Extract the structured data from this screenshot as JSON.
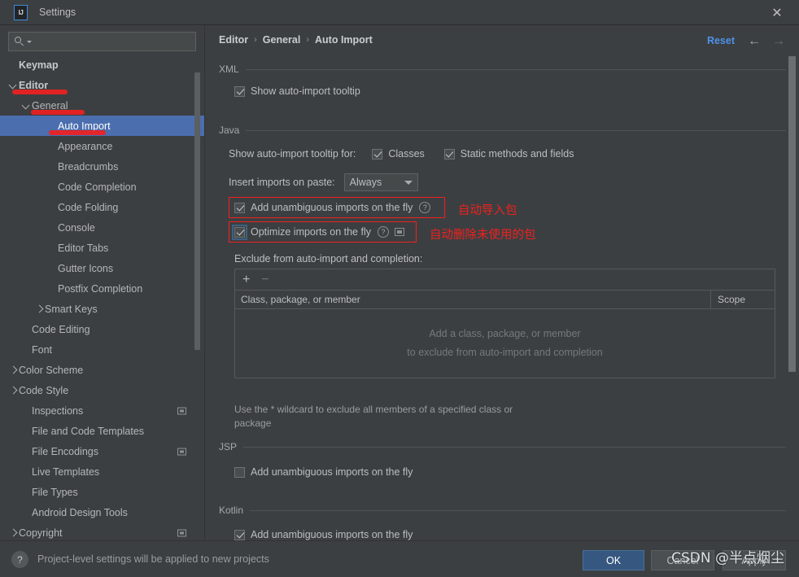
{
  "window": {
    "title": "Settings",
    "logo_text": "IJ",
    "close_label": "✕"
  },
  "sidebar": {
    "search": {
      "value": "",
      "placeholder": ""
    },
    "items": [
      {
        "label": "Keymap",
        "indent": 0,
        "arrow": "none",
        "bold": true,
        "selected": false,
        "badge": false
      },
      {
        "label": "Editor",
        "indent": 0,
        "arrow": "expanded",
        "bold": true,
        "selected": false,
        "badge": false
      },
      {
        "label": "General",
        "indent": 1,
        "arrow": "expanded",
        "bold": false,
        "selected": false,
        "badge": false
      },
      {
        "label": "Auto Import",
        "indent": 3,
        "arrow": "none",
        "bold": false,
        "selected": true,
        "badge": false
      },
      {
        "label": "Appearance",
        "indent": 3,
        "arrow": "none",
        "bold": false,
        "selected": false,
        "badge": false
      },
      {
        "label": "Breadcrumbs",
        "indent": 3,
        "arrow": "none",
        "bold": false,
        "selected": false,
        "badge": false
      },
      {
        "label": "Code Completion",
        "indent": 3,
        "arrow": "none",
        "bold": false,
        "selected": false,
        "badge": false
      },
      {
        "label": "Code Folding",
        "indent": 3,
        "arrow": "none",
        "bold": false,
        "selected": false,
        "badge": false
      },
      {
        "label": "Console",
        "indent": 3,
        "arrow": "none",
        "bold": false,
        "selected": false,
        "badge": false
      },
      {
        "label": "Editor Tabs",
        "indent": 3,
        "arrow": "none",
        "bold": false,
        "selected": false,
        "badge": false
      },
      {
        "label": "Gutter Icons",
        "indent": 3,
        "arrow": "none",
        "bold": false,
        "selected": false,
        "badge": false
      },
      {
        "label": "Postfix Completion",
        "indent": 3,
        "arrow": "none",
        "bold": false,
        "selected": false,
        "badge": false
      },
      {
        "label": "Smart Keys",
        "indent": 2,
        "arrow": "collapsed",
        "bold": false,
        "selected": false,
        "badge": false
      },
      {
        "label": "Code Editing",
        "indent": 1,
        "arrow": "none",
        "bold": false,
        "selected": false,
        "badge": false
      },
      {
        "label": "Font",
        "indent": 1,
        "arrow": "none",
        "bold": false,
        "selected": false,
        "badge": false
      },
      {
        "label": "Color Scheme",
        "indent": 0,
        "arrow": "collapsed",
        "bold": false,
        "selected": false,
        "badge": false
      },
      {
        "label": "Code Style",
        "indent": 0,
        "arrow": "collapsed",
        "bold": false,
        "selected": false,
        "badge": false
      },
      {
        "label": "Inspections",
        "indent": 1,
        "arrow": "none",
        "bold": false,
        "selected": false,
        "badge": true
      },
      {
        "label": "File and Code Templates",
        "indent": 1,
        "arrow": "none",
        "bold": false,
        "selected": false,
        "badge": false
      },
      {
        "label": "File Encodings",
        "indent": 1,
        "arrow": "none",
        "bold": false,
        "selected": false,
        "badge": true
      },
      {
        "label": "Live Templates",
        "indent": 1,
        "arrow": "none",
        "bold": false,
        "selected": false,
        "badge": false
      },
      {
        "label": "File Types",
        "indent": 1,
        "arrow": "none",
        "bold": false,
        "selected": false,
        "badge": false
      },
      {
        "label": "Android Design Tools",
        "indent": 1,
        "arrow": "none",
        "bold": false,
        "selected": false,
        "badge": false
      },
      {
        "label": "Copyright",
        "indent": 0,
        "arrow": "collapsed",
        "bold": false,
        "selected": false,
        "badge": true
      }
    ]
  },
  "breadcrumb": {
    "items": [
      "Editor",
      "General",
      "Auto Import"
    ],
    "separator": "›"
  },
  "header": {
    "reset_label": "Reset",
    "back_arrow": "←",
    "forward_arrow": "→"
  },
  "sections": {
    "xml": {
      "title": "XML",
      "show_tooltip": {
        "label": "Show auto-import tooltip",
        "checked": true
      }
    },
    "java": {
      "title": "Java",
      "tooltip_for_label": "Show auto-import tooltip for:",
      "classes": {
        "label": "Classes",
        "checked": true
      },
      "static_methods": {
        "label": "Static methods and fields",
        "checked": true
      },
      "insert_imports_label": "Insert imports on paste:",
      "insert_imports_value": "Always",
      "add_unambiguous": {
        "label": "Add unambiguous imports on the fly",
        "checked": true,
        "help": "?"
      },
      "optimize_imports": {
        "label": "Optimize imports on the fly",
        "checked": true,
        "help": "?"
      },
      "exclude_label": "Exclude from auto-import and completion:",
      "toolbar": {
        "add": "+",
        "remove": "−"
      },
      "table_headers": [
        "Class, package, or member",
        "Scope"
      ],
      "empty_line1": "Add a class, package, or member",
      "empty_line2": "to exclude from auto-import and completion",
      "hint_line1": "Use the * wildcard to exclude all members of a specified class or",
      "hint_line2": "package"
    },
    "jsp": {
      "title": "JSP",
      "add_unambiguous": {
        "label": "Add unambiguous imports on the fly",
        "checked": false
      }
    },
    "kotlin": {
      "title": "Kotlin",
      "add_unambiguous": {
        "label": "Add unambiguous imports on the fly",
        "checked": true
      }
    }
  },
  "annotations": {
    "note_add_imports": "自动导入包",
    "note_optimize_imports": "自动删除未使用的包",
    "stroke_color": "#f02020"
  },
  "footer": {
    "help_icon": "?",
    "note": "Project-level settings will be applied to new projects",
    "ok": "OK",
    "cancel": "Cancel",
    "apply": "Apply"
  },
  "watermark": {
    "text": "CSDN @半点烟尘"
  }
}
